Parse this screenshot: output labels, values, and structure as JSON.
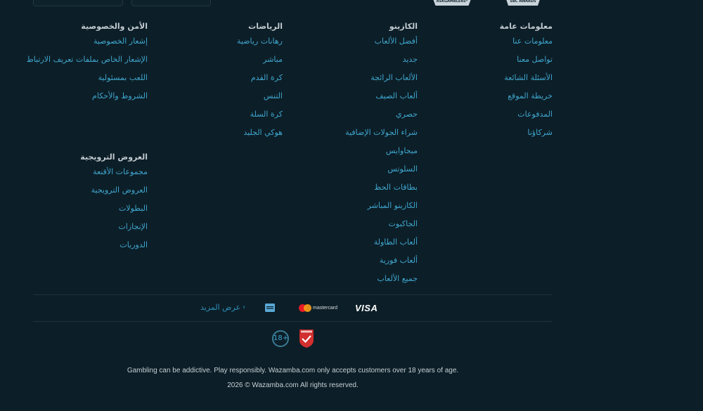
{
  "top_awards": [
    "ASKGAMBLERS*",
    "SBC AWARDS"
  ],
  "columns": [
    {
      "id": "general",
      "heading": "معلومات عامة",
      "links": [
        "معلومات عنا",
        "تواصل معنا",
        "الأسئلة الشائعة",
        "خريطة الموقع",
        "المدفوعات",
        "شركاؤنا"
      ]
    },
    {
      "id": "casino",
      "heading": "الكازينو",
      "links": [
        "أفضل الألعاب",
        "جديد",
        "الألعاب الرائجة",
        "ألعاب الصيف",
        "حصري",
        "شراء الجولات الإضافية",
        "ميجاوايس",
        "السلوتس",
        "بطاقات الحظ",
        "الكازينو المباشر",
        "الجاكبوت",
        "ألعاب الطاولة",
        "ألعاب فورية",
        "جميع الألعاب"
      ]
    },
    {
      "id": "sports",
      "heading": "الرياضات",
      "links": [
        "رهانات رياضية",
        "مباشر",
        "كرة القدم",
        "التنس",
        "كرة السلة",
        "هوكي الجليد"
      ]
    },
    {
      "id": "security",
      "heading": "الأمن والخصوصية",
      "links": [
        "إشعار الخصوصية",
        "الإشعار الخاص بملفات تعريف الارتباط",
        "اللعب بمسئولية",
        "الشروط والأحكام"
      ]
    },
    {
      "id": "promotions",
      "heading": "العروض الترويجية",
      "links": [
        "مجموعات الأقنعة",
        "العروض الترويجية",
        "البطولات",
        "الإنجازات",
        "الدوريات"
      ]
    }
  ],
  "payments": {
    "more_label": "عرض المزيد",
    "methods": [
      "amex",
      "mastercard",
      "VISA"
    ],
    "mastercard_label": "mastercard"
  },
  "badges": {
    "age": "18+",
    "seal_icon": "responsible-gaming-seal"
  },
  "legal": {
    "disclaimer": "Gambling can be addictive. Play responsibly. Wazamba.com only accepts customers over 18 years of age.",
    "copyright": "2026 © Wazamba.com All rights reserved."
  },
  "colors": {
    "background": "#0c1e27",
    "link": "#3fa6cf",
    "heading": "#c2cad0"
  }
}
